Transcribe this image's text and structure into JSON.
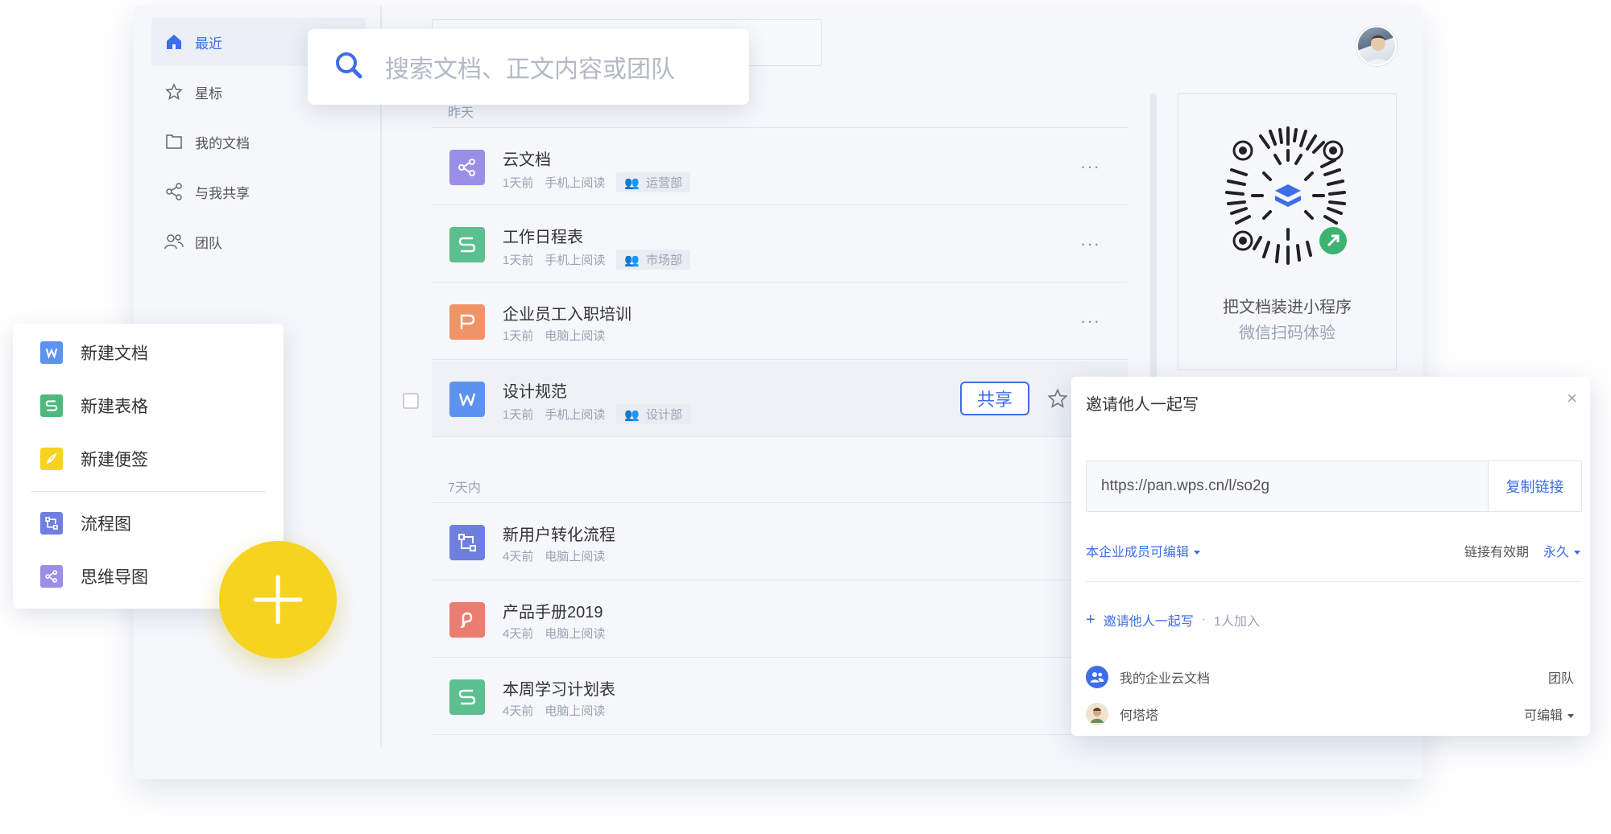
{
  "sidebar": {
    "items": [
      {
        "label": "最近",
        "icon": "home-icon",
        "active": true
      },
      {
        "label": "星标",
        "icon": "star-icon"
      },
      {
        "label": "我的文档",
        "icon": "folder-icon"
      },
      {
        "label": "与我共享",
        "icon": "share-icon"
      },
      {
        "label": "团队",
        "icon": "team-icon"
      }
    ]
  },
  "search": {
    "placeholder": "搜索文档、正文内容或团队",
    "icon": "search-icon"
  },
  "groups": {
    "yesterday": "昨天",
    "week": "7天内"
  },
  "docs": [
    {
      "title": "云文档",
      "time": "1天前",
      "device": "手机上阅读",
      "team": "运营部",
      "icon": "mindmap-icon",
      "color": "#9b8ee6"
    },
    {
      "title": "工作日程表",
      "time": "1天前",
      "device": "手机上阅读",
      "team": "市场部",
      "icon": "sheet-icon",
      "color": "#5cbf8f"
    },
    {
      "title": "企业员工入职培训",
      "time": "1天前",
      "device": "电脑上阅读",
      "icon": "slides-icon",
      "color": "#ef9466"
    },
    {
      "title": "设计规范",
      "time": "1天前",
      "device": "手机上阅读",
      "team": "设计部",
      "icon": "word-icon",
      "color": "#5b93ef"
    },
    {
      "title": "新用户转化流程",
      "time": "4天前",
      "device": "电脑上阅读",
      "icon": "flowchart-icon",
      "color": "#6f7fe0"
    },
    {
      "title": "产品手册2019",
      "time": "4天前",
      "device": "电脑上阅读",
      "icon": "pdf-icon",
      "color": "#ea7d72"
    },
    {
      "title": "本周学习计划表",
      "time": "4天前",
      "device": "电脑上阅读",
      "icon": "sheet-icon",
      "color": "#5cbf8f"
    }
  ],
  "row_actions": {
    "share_label": "共享",
    "more": "···"
  },
  "qr": {
    "title": "把文档装进小程序",
    "subtitle": "微信扫码体验"
  },
  "new_menu": {
    "items": [
      {
        "label": "新建文档",
        "icon": "word-icon",
        "color": "#5b93ef"
      },
      {
        "label": "新建表格",
        "icon": "sheet-icon",
        "color": "#4fb97d"
      },
      {
        "label": "新建便签",
        "icon": "note-icon",
        "color": "#f5d31f"
      },
      {
        "label": "流程图",
        "icon": "flowchart-icon",
        "color": "#6f7fe0"
      },
      {
        "label": "思维导图",
        "icon": "mindmap-icon",
        "color": "#9b8ee6"
      }
    ]
  },
  "invite": {
    "title": "邀请他人一起写",
    "url": "https://pan.wps.cn/l/so2g",
    "copy_label": "复制链接",
    "permission": "本企业成员可编辑",
    "validity_label": "链接有效期",
    "validity_value": "永久",
    "add_label": "邀请他人一起写",
    "joined": "1人加入",
    "members": [
      {
        "name": "我的企业云文档",
        "role": "团队"
      },
      {
        "name": "何塔塔",
        "role": "可编辑"
      }
    ]
  },
  "colors": {
    "accent": "#3d6ee8",
    "fab": "#f5d31f"
  }
}
